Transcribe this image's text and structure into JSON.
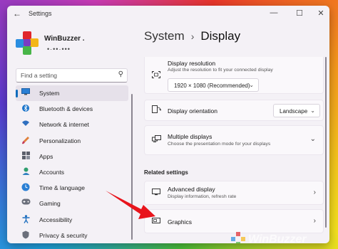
{
  "window": {
    "title": "Settings",
    "back_icon": "back-arrow-icon"
  },
  "controls": {
    "minimize": "—",
    "maximize": "☐",
    "close": "✕"
  },
  "brand": {
    "name": "WinBuzzer .",
    "sub": "•·••·•••"
  },
  "search": {
    "placeholder": "Find a setting",
    "icon": "search-icon"
  },
  "nav": {
    "items": [
      {
        "label": "System",
        "icon": "monitor-icon",
        "selected": true
      },
      {
        "label": "Bluetooth & devices",
        "icon": "bluetooth-icon"
      },
      {
        "label": "Network & internet",
        "icon": "wifi-icon"
      },
      {
        "label": "Personalization",
        "icon": "brush-icon"
      },
      {
        "label": "Apps",
        "icon": "apps-icon"
      },
      {
        "label": "Accounts",
        "icon": "person-icon"
      },
      {
        "label": "Time & language",
        "icon": "globe-clock-icon"
      },
      {
        "label": "Gaming",
        "icon": "gamepad-icon"
      },
      {
        "label": "Accessibility",
        "icon": "accessibility-icon"
      },
      {
        "label": "Privacy & security",
        "icon": "shield-icon"
      }
    ]
  },
  "header": {
    "parent": "System",
    "separator": "›",
    "current": "Display"
  },
  "settings": {
    "resolution": {
      "title": "Display resolution",
      "subtitle": "Adjust the resolution to fit your connected display",
      "value": "1920 × 1080 (Recommended)"
    },
    "orientation": {
      "title": "Display orientation",
      "value": "Landscape"
    },
    "multiple": {
      "title": "Multiple displays",
      "subtitle": "Choose the presentation mode for your displays"
    }
  },
  "related": {
    "heading": "Related settings",
    "advanced": {
      "title": "Advanced display",
      "subtitle": "Display information, refresh rate"
    },
    "graphics": {
      "title": "Graphics"
    }
  },
  "watermark": {
    "text": "WinBuzzer"
  },
  "colors": {
    "accent": "#0f6cbd",
    "arrow": "#e8141c"
  }
}
